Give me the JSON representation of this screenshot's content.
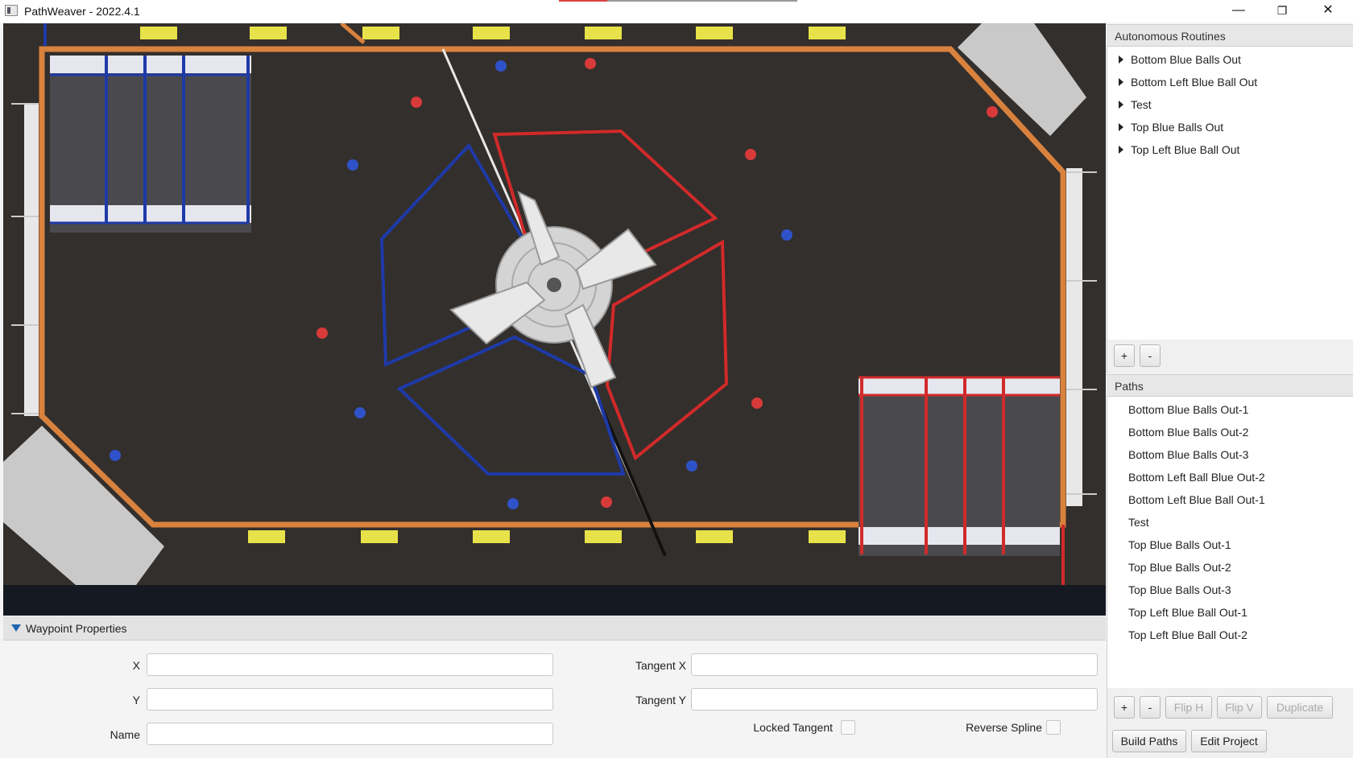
{
  "window": {
    "title": "PathWeaver - 2022.4.1",
    "minimize": "—",
    "restore": "❐",
    "close": "✕"
  },
  "field": {
    "colors": {
      "carpet": "#332f2c",
      "border": "#d9823e",
      "red": "#d12a2a",
      "blue": "#1e3aa8",
      "hub": "#d8d8d8"
    },
    "cargo_red": 8,
    "cargo_blue": 8
  },
  "routines": {
    "header": "Autonomous Routines",
    "items": [
      "Bottom Blue Balls Out",
      "Bottom Left Blue Ball Out",
      "Test",
      "Top Blue Balls Out",
      "Top Left Blue Ball Out"
    ],
    "add_label": "+",
    "remove_label": "-"
  },
  "paths": {
    "header": "Paths",
    "items": [
      "Bottom Blue Balls Out-1",
      "Bottom Blue Balls Out-2",
      "Bottom Blue Balls Out-3",
      "Bottom Left Ball Blue Out-2",
      "Bottom Left Blue Ball Out-1",
      "Test",
      "Top Blue Balls Out-1",
      "Top Blue Balls Out-2",
      "Top Blue Balls Out-3",
      "Top Left Blue Ball Out-1",
      "Top Left Blue Ball Out-2"
    ],
    "add_label": "+",
    "remove_label": "-",
    "flip_h_label": "Flip H",
    "flip_v_label": "Flip V",
    "duplicate_label": "Duplicate"
  },
  "actions": {
    "build_paths": "Build Paths",
    "edit_project": "Edit Project"
  },
  "waypoint": {
    "header": "Waypoint Properties",
    "x_label": "X",
    "y_label": "Y",
    "name_label": "Name",
    "tangent_x_label": "Tangent X",
    "tangent_y_label": "Tangent Y",
    "locked_tangent_label": "Locked Tangent",
    "reverse_spline_label": "Reverse Spline",
    "x_value": "",
    "y_value": "",
    "name_value": "",
    "tangent_x_value": "",
    "tangent_y_value": "",
    "locked_tangent": false,
    "reverse_spline": false
  }
}
